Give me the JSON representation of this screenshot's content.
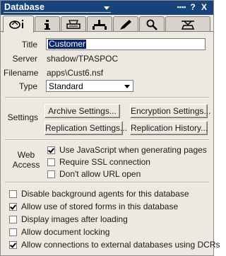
{
  "window": {
    "title": "Database",
    "menu_icon": "dots-icon",
    "help_label": "?",
    "close_label": "X"
  },
  "tabs": [
    {
      "name": "basics",
      "icon": "basics-icon",
      "active": true
    },
    {
      "name": "info",
      "icon": "info-icon",
      "active": false
    },
    {
      "name": "printer",
      "icon": "printer-icon",
      "active": false
    },
    {
      "name": "design",
      "icon": "design-icon",
      "active": false
    },
    {
      "name": "launch",
      "icon": "launch-icon",
      "active": false
    },
    {
      "name": "full-text",
      "icon": "magnifier-icon",
      "active": false
    },
    {
      "name": "advanced",
      "icon": "advanced-icon",
      "active": false
    }
  ],
  "fields": {
    "title_label": "Title",
    "title_value": "Customer",
    "server_label": "Server",
    "server_value": "shadow/TPASPOC",
    "filename_label": "Filename",
    "filename_value": "apps\\Cust6.nsf",
    "type_label": "Type",
    "type_value": "Standard"
  },
  "settings": {
    "label": "Settings",
    "archive": "Archive Settings...",
    "encryption": "Encryption Settings...",
    "replication": "Replication Settings...",
    "history": "Replication History..."
  },
  "web_access": {
    "label_line1": "Web",
    "label_line2": "Access",
    "options": [
      {
        "label": "Use JavaScript when generating pages",
        "checked": true
      },
      {
        "label": "Require SSL connection",
        "checked": false
      },
      {
        "label": "Don't allow URL open",
        "checked": false
      }
    ]
  },
  "options": [
    {
      "label": "Disable background agents for this database",
      "checked": false
    },
    {
      "label": "Allow use of stored forms in this database",
      "checked": true
    },
    {
      "label": "Display images after loading",
      "checked": false
    },
    {
      "label": "Allow document locking",
      "checked": false
    },
    {
      "label": "Allow connections to external databases using DCRs",
      "checked": true
    }
  ]
}
